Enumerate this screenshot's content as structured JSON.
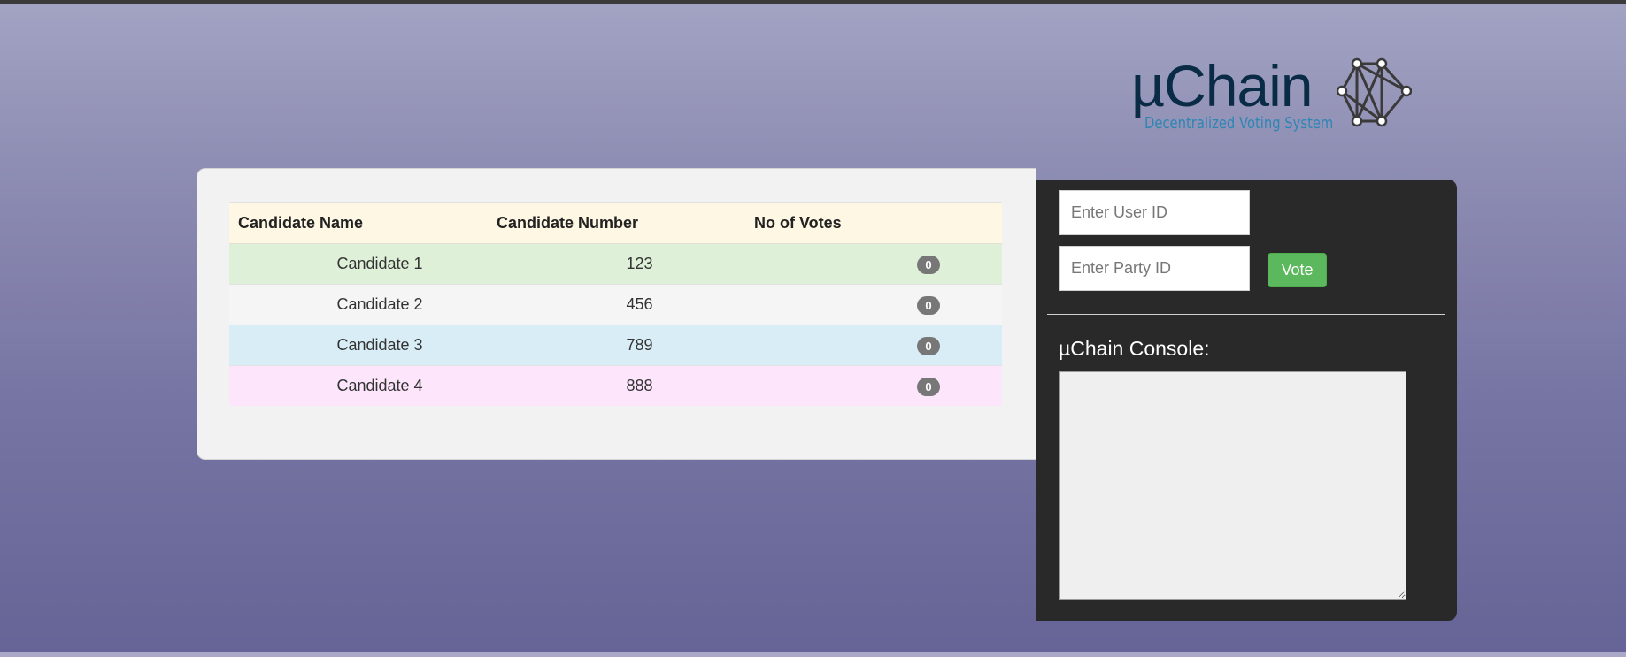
{
  "brand": {
    "title": "µChain",
    "subtitle": "Decentralized Voting System",
    "logo_icon": "network-graph-icon"
  },
  "table": {
    "headers": [
      "Candidate Name",
      "Candidate Number",
      "No of Votes"
    ],
    "rows": [
      {
        "name": "Candidate 1",
        "number": "123",
        "votes": "0",
        "color": "#dff0d8"
      },
      {
        "name": "Candidate 2",
        "number": "456",
        "votes": "0",
        "color": "#f5f5f5"
      },
      {
        "name": "Candidate 3",
        "number": "789",
        "votes": "0",
        "color": "#d9edf7"
      },
      {
        "name": "Candidate 4",
        "number": "888",
        "votes": "0",
        "color": "#fde6fb"
      }
    ],
    "header_color": "#fdf7e3"
  },
  "form": {
    "user_id_placeholder": "Enter User ID",
    "user_id_value": "",
    "party_id_placeholder": "Enter Party ID",
    "party_id_value": "",
    "vote_label": "Vote",
    "vote_color": "#5cb85c"
  },
  "console": {
    "label": "µChain Console:",
    "content": ""
  },
  "colors": {
    "panel_dark": "#292929",
    "panel_light": "#f2f2f2",
    "logo_dark": "#0a2b45",
    "logo_accent": "#2d86b4"
  }
}
